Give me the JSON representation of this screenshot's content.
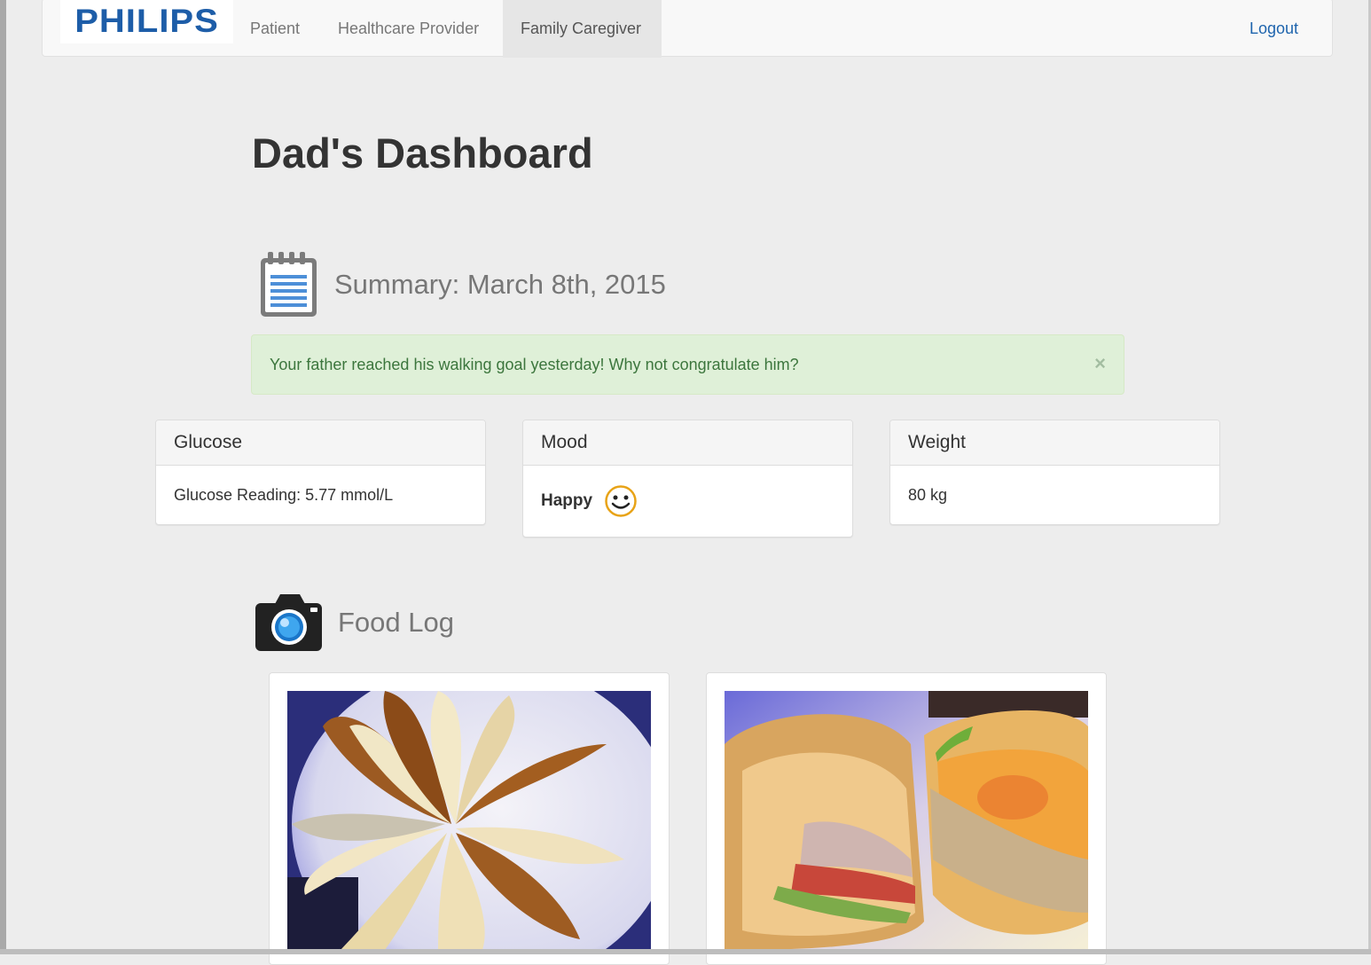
{
  "navbar": {
    "brand": "PHILIPS",
    "items": [
      {
        "label": "Patient"
      },
      {
        "label": "Healthcare Provider"
      },
      {
        "label": "Family Caregiver",
        "active": true
      }
    ],
    "logout_label": "Logout"
  },
  "page": {
    "title": "Dad's Dashboard"
  },
  "summary": {
    "icon": "notepad-icon",
    "title": "Summary: March 8th, 2015"
  },
  "alert": {
    "message": "Your father reached his walking goal yesterday! Why not congratulate him?",
    "close_label": "×"
  },
  "panels": {
    "glucose": {
      "heading": "Glucose",
      "body": "Glucose Reading: 5.77 mmol/L"
    },
    "mood": {
      "heading": "Mood",
      "body": "Happy",
      "icon": "smiley-face-icon"
    },
    "weight": {
      "heading": "Weight",
      "body": "80 kg"
    }
  },
  "food_log": {
    "icon": "camera-icon",
    "title": "Food Log",
    "photos": [
      {
        "subject": "sliced-pears-photo"
      },
      {
        "subject": "sandwich-photo"
      }
    ]
  },
  "colors": {
    "brand": "#1d5da8",
    "link": "#1e64ad",
    "alert_bg": "#dff0d8",
    "alert_text": "#3c763d",
    "smiley": "#e8a317"
  }
}
